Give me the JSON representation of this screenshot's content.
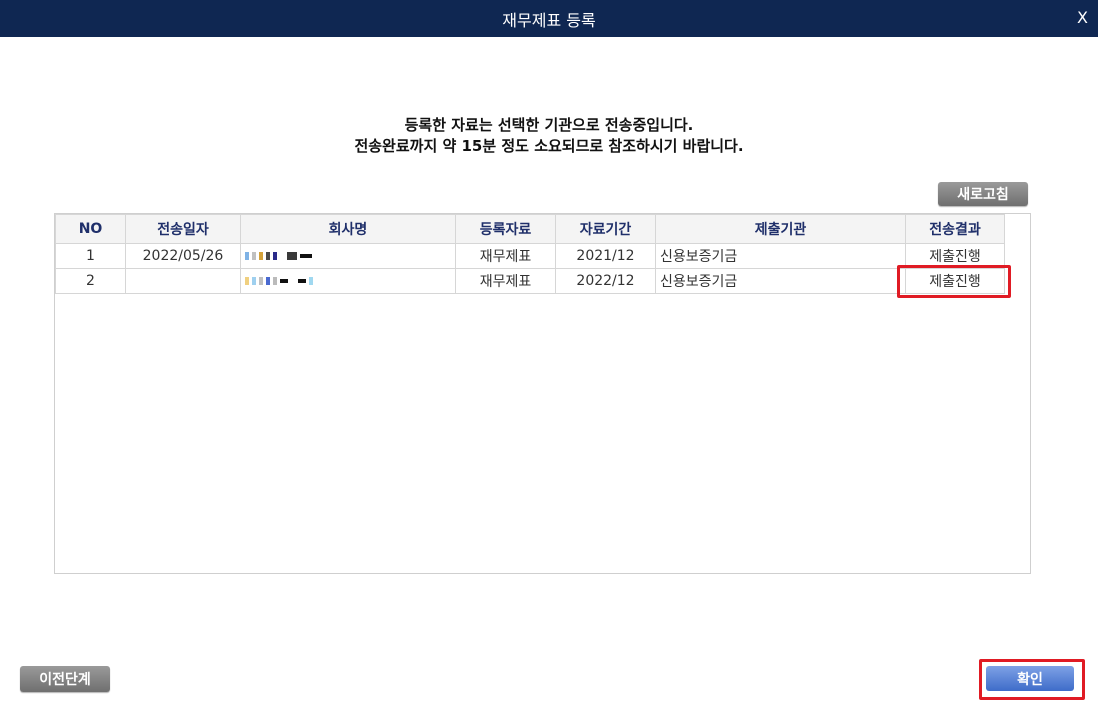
{
  "window": {
    "title": "재무제표 등록",
    "close_label": "X"
  },
  "message": {
    "line1": "등록한 자료는 선택한 기관으로 전송중입니다.",
    "line2": "전송완료까지 약 15분 정도 소요되므로 참조하시기 바랍니다."
  },
  "buttons": {
    "refresh": "새로고침",
    "prev": "이전단계",
    "confirm": "확인"
  },
  "table": {
    "headers": [
      "NO",
      "전송일자",
      "회사명",
      "등록자료",
      "자료기간",
      "제출기관",
      "전송결과"
    ],
    "rows": [
      {
        "no": "1",
        "date": "2022/05/26",
        "company": "",
        "doc": "재무제표",
        "period": "2021/12",
        "agency": "신용보증기금",
        "result": "제출진행"
      },
      {
        "no": "2",
        "date": "",
        "company": "",
        "doc": "재무제표",
        "period": "2022/12",
        "agency": "신용보증기금",
        "result": "제출진행"
      }
    ]
  },
  "colors": {
    "titlebar": "#0f2752",
    "highlight": "#e01b24",
    "confirm": "#4a78d0"
  }
}
